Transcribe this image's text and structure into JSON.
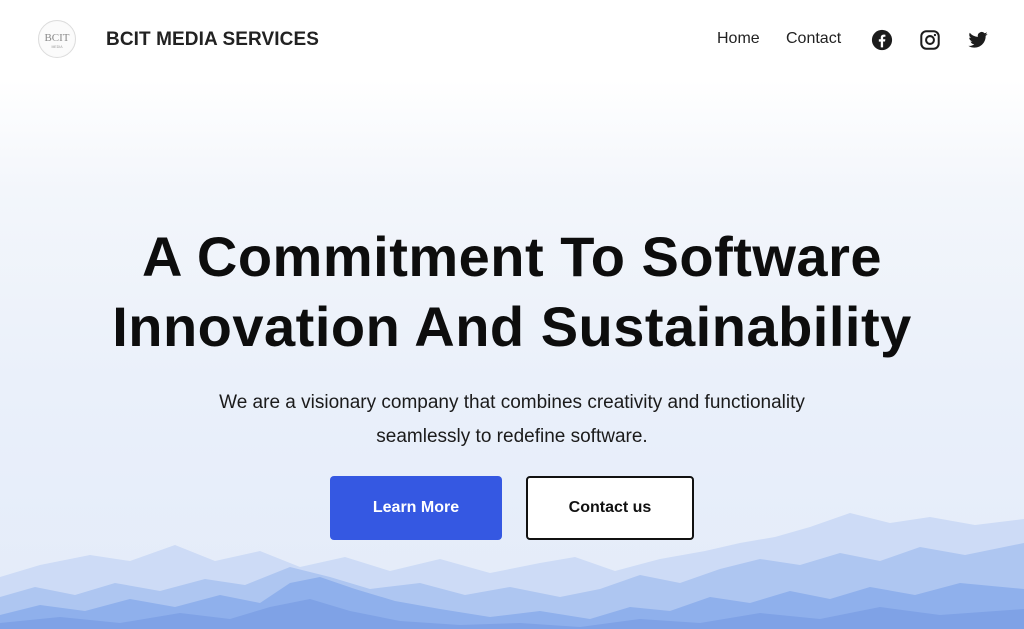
{
  "header": {
    "logo_text": "BCIT",
    "logo_subtext": "MEDIA",
    "site_title": "BCIT MEDIA SERVICES",
    "nav": [
      {
        "label": "Home"
      },
      {
        "label": "Contact"
      }
    ],
    "social_icons": [
      "facebook-icon",
      "instagram-icon",
      "twitter-icon"
    ]
  },
  "hero": {
    "title_line1": "A Commitment To Software",
    "title_line2": "Innovation And Sustainability",
    "subtitle_line1": "We are a visionary company that combines creativity and functionality",
    "subtitle_line2": "seamlessly to redefine software.",
    "primary_button": "Learn More",
    "secondary_button": "Contact us"
  },
  "colors": {
    "accent": "#3558e2",
    "text": "#111111",
    "mountain_far": "#c9d7f5",
    "mountain_near": "#8fb0ec"
  }
}
